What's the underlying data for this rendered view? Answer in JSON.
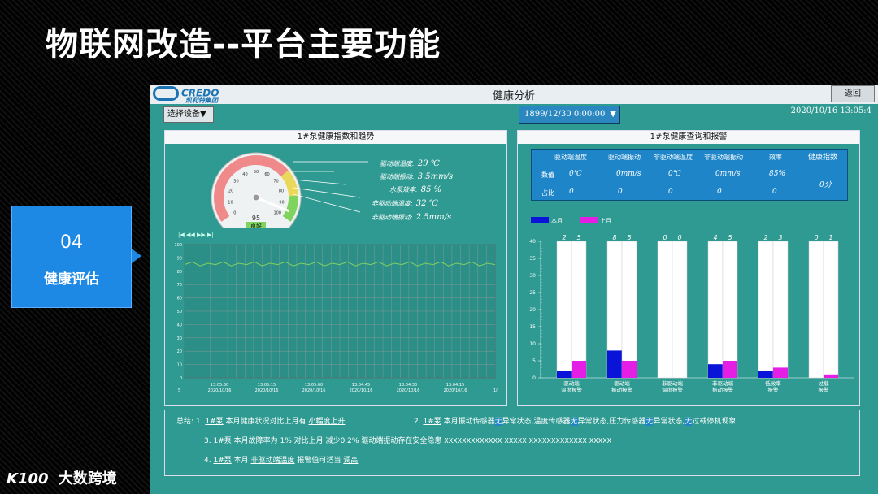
{
  "slide": {
    "title": "物联网改造--平台主要功能",
    "section_number": "04",
    "section_label": "健康评估",
    "brand": "大数跨境",
    "brand_logo": "K100"
  },
  "app": {
    "logo": "CREDO",
    "logo_sub": "凯利特集团",
    "window_title": "健康分析",
    "back_label": "返回",
    "select_device_label": "选择设备▼",
    "date_select_value": "1899/12/30  0:00:00",
    "datetime": "2020/10/16  13:05:4"
  },
  "left_panel": {
    "title": "1#泵健康指数和趋势",
    "gauge": {
      "value": 95,
      "status": "良好",
      "ticks": [
        "0",
        "10",
        "20",
        "30",
        "40",
        "50",
        "60",
        "70",
        "80",
        "90",
        "100"
      ],
      "colors": {
        "red": "#f08a8a",
        "yellow": "#e9d85a",
        "green": "#7fd35f"
      }
    },
    "readings": [
      {
        "label": "驱动端温度:",
        "value": "29 ℃"
      },
      {
        "label": "驱动端振动:",
        "value": "3.5mm/s"
      },
      {
        "label": "水泵效率:",
        "value": "85 %"
      },
      {
        "label": "非驱动端温度:",
        "value": "32 ℃"
      },
      {
        "label": "非驱动端振动:",
        "value": "2.5mm/s"
      }
    ],
    "player_controls": "|◀  ◀◀  ▶▶  ▶|"
  },
  "chart_data": [
    {
      "type": "line",
      "title": "",
      "xlabel": "",
      "ylabel": "",
      "ylim": [
        0,
        100
      ],
      "y_ticks": [
        "0",
        "10",
        "20",
        "30",
        "40",
        "50",
        "60",
        "70",
        "80",
        "90",
        "100"
      ],
      "x_ticks": [
        {
          "time": "13:05:30",
          "date": "2020/10/16"
        },
        {
          "time": "13:05:15",
          "date": "2020/10/16"
        },
        {
          "time": "13:05:00",
          "date": "2020/10/16"
        },
        {
          "time": "13:04:45",
          "date": "2020/10/16"
        },
        {
          "time": "13:04:30",
          "date": "2020/10/16"
        },
        {
          "time": "13:04:15",
          "date": "2020/10/16"
        }
      ],
      "x_edge_labels": [
        "5",
        "1("
      ],
      "series": [
        {
          "values": [
            85,
            87,
            84,
            86,
            85,
            87,
            84,
            86,
            85,
            87,
            84,
            86,
            85,
            87,
            84,
            86,
            85,
            87,
            84,
            86,
            85,
            87,
            84,
            86,
            85,
            87,
            84,
            86,
            85,
            87,
            84,
            86,
            85,
            87,
            84,
            86,
            85,
            87,
            84,
            86,
            85
          ],
          "color": "#7fd35f"
        }
      ],
      "grid": true
    },
    {
      "type": "bar",
      "title": "",
      "ylim": [
        0,
        40
      ],
      "y_ticks": [
        "0",
        "5",
        "10",
        "15",
        "20",
        "25",
        "30",
        "35",
        "40"
      ],
      "categories": [
        [
          "驱动端",
          "温度报警"
        ],
        [
          "驱动端",
          "振动报警"
        ],
        [
          "非驱动端",
          "温度报警"
        ],
        [
          "非驱动端",
          "振动报警"
        ],
        [
          "低效率",
          "报警"
        ],
        [
          "过载",
          "报警"
        ]
      ],
      "series": [
        {
          "name": "本月",
          "color": "#0a14d8",
          "values": [
            2,
            8,
            0,
            4,
            2,
            0
          ]
        },
        {
          "name": "上月",
          "color": "#e51ee5",
          "values": [
            5,
            5,
            0,
            5,
            3,
            1
          ]
        }
      ],
      "top_labels": [
        [
          "2",
          "5"
        ],
        [
          "8",
          "5"
        ],
        [
          "0",
          "0"
        ],
        [
          "4",
          "5"
        ],
        [
          "2",
          "3"
        ],
        [
          "0",
          "1"
        ]
      ],
      "legend": "top-left",
      "grid": false
    }
  ],
  "right_panel": {
    "title": "1#泵健康查询和报警",
    "stats": {
      "headers": [
        "驱动端温度",
        "驱动端振动",
        "非驱动端温度",
        "非驱动端振动",
        "效率",
        "健康指数"
      ],
      "row1_label": "数值",
      "row2_label": "占比",
      "row1": [
        "0℃",
        "0mm/s",
        "0℃",
        "0mm/s",
        "85%"
      ],
      "row2": [
        "0",
        "0",
        "0",
        "0",
        "0"
      ],
      "health": "0分"
    }
  },
  "summary": {
    "label": "总结:",
    "items": [
      {
        "n": "1.",
        "pump": "1#泵",
        "text1": "本月健康状况对比上月有",
        "hl": "小幅度上升"
      },
      {
        "n": "2.",
        "pump": "1#泵",
        "text": "本月振动传感器",
        "s1": "无",
        "t1": "异常状态,温度传感器",
        "s2": "无",
        "t2": "异常状态,压力传感器",
        "s3": "无",
        "t3": "异常状态,",
        "s4": "无",
        "t4": "过载停机现象"
      },
      {
        "n": "3.",
        "pump": "1#泵",
        "text1": "本月故障率为",
        "v1": "1%",
        "text2": "对比上月",
        "v2": "减少0.2%",
        "v3": "驱动端振动存在",
        "text3": "安全隐患",
        "x1": "XXXXXXXXXXXXX",
        "x2": "XXXXX",
        "x3": "XXXXXXXXXXXXX",
        "x4": "XXXXX"
      },
      {
        "n": "4.",
        "pump": "1#泵",
        "text1": "本月",
        "v1": "非驱动端温度",
        "text2": "报警值可适当",
        "v2": "调高"
      }
    ]
  }
}
